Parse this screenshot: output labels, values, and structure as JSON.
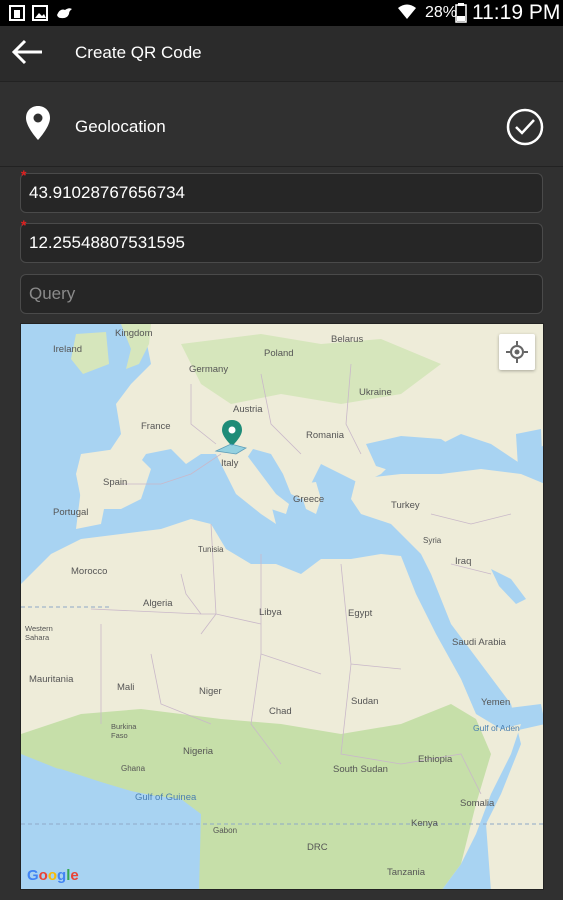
{
  "status_bar": {
    "battery": "28%",
    "time": "11:19 PM",
    "icons": [
      "notification-icon",
      "image-icon",
      "bird-icon",
      "wifi-icon",
      "battery-icon"
    ]
  },
  "app_bar": {
    "title": "Create QR Code",
    "back_icon": "arrow-left-icon"
  },
  "type_row": {
    "label": "Geolocation",
    "icon": "location-pin-icon",
    "confirm_icon": "check-circle-icon"
  },
  "form": {
    "latitude": "43.91028767656734",
    "longitude": "12.25548807531595",
    "query_placeholder": "Query",
    "required_marker": "*"
  },
  "map": {
    "labels": {
      "kingdom": "Kingdom",
      "ireland": "Ireland",
      "belarus": "Belarus",
      "germany": "Germany",
      "poland": "Poland",
      "ukraine": "Ukraine",
      "austria": "Austria",
      "france": "France",
      "romania": "Romania",
      "italy": "Italy",
      "spain": "Spain",
      "greece": "Greece",
      "portugal": "Portugal",
      "turkey": "Turkey",
      "tunisia": "Tunisia",
      "syria": "Syria",
      "morocco": "Morocco",
      "iraq": "Iraq",
      "algeria": "Algeria",
      "libya": "Libya",
      "egypt": "Egypt",
      "western_sahara": "Western Sahara",
      "saudi_arabia": "Saudi Arabia",
      "mauritania": "Mauritania",
      "mali": "Mali",
      "niger": "Niger",
      "chad": "Chad",
      "sudan": "Sudan",
      "yemen": "Yemen",
      "burkina_faso": "Burkina Faso",
      "nigeria": "Nigeria",
      "gulf_of_aden": "Gulf of Aden",
      "ghana": "Ghana",
      "ethiopia": "Ethiopia",
      "south_sudan": "South Sudan",
      "gulf_of_guinea": "Gulf of Guinea",
      "somalia": "Somalia",
      "gabon": "Gabon",
      "kenya": "Kenya",
      "drc": "DRC",
      "tanzania": "Tanzania"
    },
    "logo": [
      "G",
      "o",
      "o",
      "g",
      "l",
      "e"
    ],
    "colors": {
      "water": "#a8d3f2",
      "land": "#eeecd9",
      "green": "#c6dfa9",
      "marker": "#1e8c78"
    }
  }
}
